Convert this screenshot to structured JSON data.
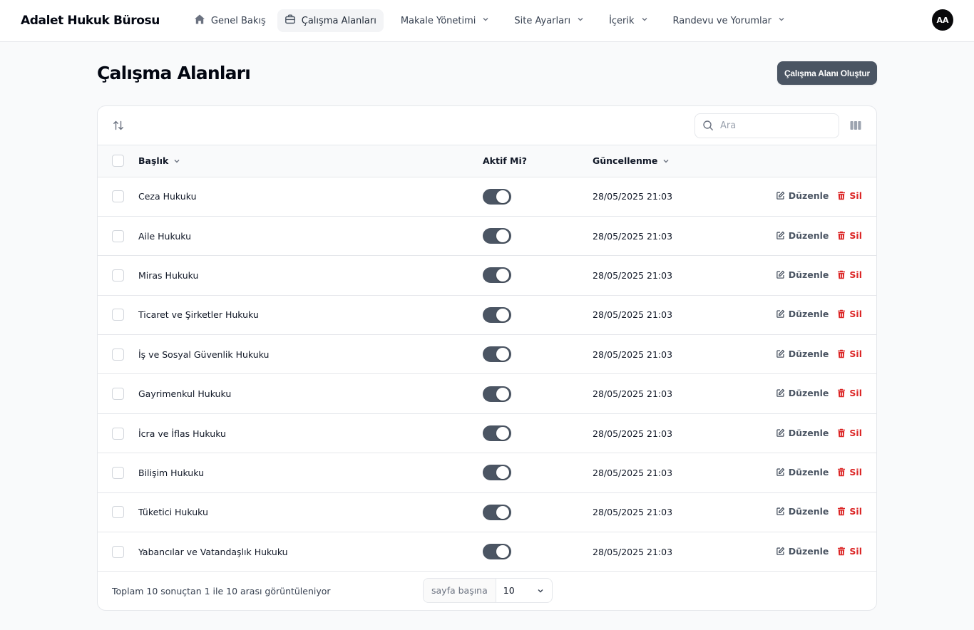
{
  "app": {
    "brand": "Adalet Hukuk Bürosu",
    "avatar_initials": "AA"
  },
  "nav": {
    "items": [
      {
        "label": "Genel Bakış",
        "icon": "home-icon"
      },
      {
        "label": "Çalışma Alanları",
        "icon": "briefcase-icon",
        "active": true
      },
      {
        "label": "Makale Yönetimi",
        "icon": "chevron-down-icon"
      },
      {
        "label": "Site Ayarları",
        "icon": "chevron-down-icon"
      },
      {
        "label": "İçerik",
        "icon": "chevron-down-icon"
      },
      {
        "label": "Randevu ve Yorumlar",
        "icon": "chevron-down-icon"
      }
    ]
  },
  "page": {
    "title": "Çalışma Alanları",
    "create_button": "Çalışma Alanı Oluştur"
  },
  "toolbar": {
    "search_placeholder": "Ara"
  },
  "table": {
    "columns": {
      "title": "Başlık",
      "active": "Aktif Mi?",
      "updated": "Güncellenme"
    },
    "action_labels": {
      "edit": "Düzenle",
      "delete": "Sil"
    },
    "rows": [
      {
        "title": "Ceza Hukuku",
        "active": true,
        "updated": "28/05/2025 21:03"
      },
      {
        "title": "Aile Hukuku",
        "active": true,
        "updated": "28/05/2025 21:03"
      },
      {
        "title": "Miras Hukuku",
        "active": true,
        "updated": "28/05/2025 21:03"
      },
      {
        "title": "Ticaret ve Şirketler Hukuku",
        "active": true,
        "updated": "28/05/2025 21:03"
      },
      {
        "title": "İş ve Sosyal Güvenlik Hukuku",
        "active": true,
        "updated": "28/05/2025 21:03"
      },
      {
        "title": "Gayrimenkul Hukuku",
        "active": true,
        "updated": "28/05/2025 21:03"
      },
      {
        "title": "İcra ve İflas Hukuku",
        "active": true,
        "updated": "28/05/2025 21:03"
      },
      {
        "title": "Bilişim Hukuku",
        "active": true,
        "updated": "28/05/2025 21:03"
      },
      {
        "title": "Tüketici Hukuku",
        "active": true,
        "updated": "28/05/2025 21:03"
      },
      {
        "title": "Yabancılar ve Vatandaşlık Hukuku",
        "active": true,
        "updated": "28/05/2025 21:03"
      }
    ]
  },
  "pagination": {
    "summary": "Toplam 10 sonuçtan 1 ile 10 arası görüntüleniyor",
    "per_page_label": "sayfa başına",
    "per_page_value": "10"
  },
  "colors": {
    "primary": "#4b5563",
    "danger": "#dc2626",
    "toggle_on": "#4b5563"
  }
}
